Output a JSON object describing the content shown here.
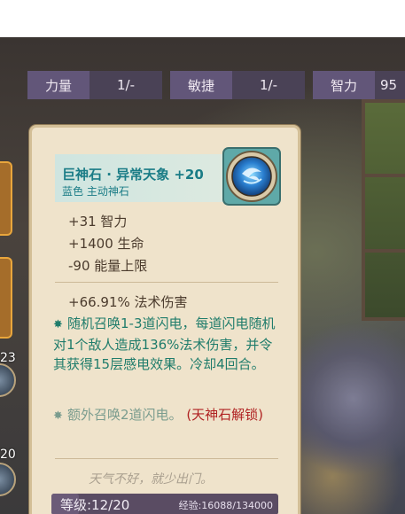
{
  "stats": [
    {
      "label": "力量",
      "value": "1/-"
    },
    {
      "label": "敏捷",
      "value": "1/-"
    },
    {
      "label": "智力",
      "value": "95"
    }
  ],
  "left_numbers": [
    "23",
    "20"
  ],
  "item": {
    "name": "巨神石 · 异常天象 +20",
    "subtitle": "蓝色 主动神石",
    "base_stats": [
      "+31 智力",
      "+1400 生命",
      "-90 能量上限"
    ],
    "damage": "+66.91% 法术伤害",
    "effect_main": "随机召唤1-3道闪电，每道闪电随机对1个敌人造成136%法术伤害，并令其获得15层感电效果。冷却4回合。",
    "effect_extra": "额外召唤2道闪电。",
    "effect_extra_lock": "(天神石解锁)",
    "flavor": "天气不好，就少出门。",
    "level": "等级:12/20",
    "experience": "经验:16088/134000",
    "exp_progress": 0.12
  },
  "colors": {
    "card_bg": "#efe3cb",
    "name_teal": "#1a7c86",
    "effect_teal": "#1f7c6b",
    "lock_red": "#b02222",
    "level_bar": "#5a4c63"
  },
  "icons": {
    "gem": "blue-lightning-gem-icon",
    "star": "star-icon"
  }
}
